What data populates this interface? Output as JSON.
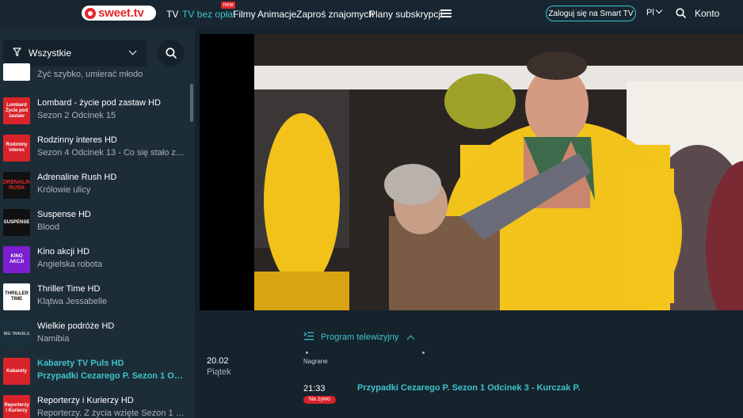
{
  "header": {
    "logo_text": "sweet.tv",
    "nav": [
      {
        "label": "TV"
      },
      {
        "label": "TV bez opłat",
        "badge": "new"
      },
      {
        "label": "Filmy"
      },
      {
        "label": "Animacje"
      },
      {
        "label": "Zaproś znajomych"
      },
      {
        "label": "Plany subskrypcji"
      }
    ],
    "smart_tv_button": "Zaloguj się na Smart TV",
    "language": "Pl",
    "account": "Konto"
  },
  "sidebar": {
    "filter_label": "Wszystkie",
    "channels": [
      {
        "name": "",
        "show": "Żyć szybko, umierać młodo",
        "logo_text": "",
        "logo_color": "#e5262b"
      },
      {
        "name": "Lombard - życie pod zastaw HD",
        "show": "Sezon 2 Odcinek 15",
        "logo_text": "Lombard Życie pod zastaw",
        "logo_color": "#d9232a"
      },
      {
        "name": "Rodzinny interes HD",
        "show": "Sezon 4 Odcinek 13 - Co się stało z ci...",
        "logo_text": "Rodzinny interes",
        "logo_color": "#d9232a"
      },
      {
        "name": "Adrenaline Rush HD",
        "show": "Królowie ulicy",
        "logo_text": "ADRENALINE RUSH",
        "logo_color": "#111111"
      },
      {
        "name": "Suspense HD",
        "show": "Blood",
        "logo_text": "SUSPENSE",
        "logo_color": "#111111"
      },
      {
        "name": "Kino akcji HD",
        "show": "Angielska robota",
        "logo_text": "KINO AKCJI",
        "logo_color": "#7b1fd1"
      },
      {
        "name": "Thriller Time HD",
        "show": "Klątwa Jessabelle",
        "logo_text": "THRILLER TIME",
        "logo_color": "#ffffff"
      },
      {
        "name": "Wielkie podróże HD",
        "show": "Namibia",
        "logo_text": "BIG TRAVELS",
        "logo_color": "#18303a"
      },
      {
        "name": "Kabarety TV Puls HD",
        "show": "Przypadki Cezarego P. Sezon 1 Odcinek...",
        "logo_text": "Kabarety",
        "logo_color": "#d9232a",
        "active": true
      },
      {
        "name": "Reporterzy i Kurierzy HD",
        "show": "Reporterzy. Z życia wzięte Sezon 1 Od...",
        "logo_text": "Reporterzy i Kurierzy",
        "logo_color": "#d9232a"
      }
    ]
  },
  "epg": {
    "toggle_label": "Program telewizyjny",
    "date": "20.02",
    "day": "Piątek",
    "recorded_label": "Nagrane",
    "time": "21:33",
    "live_label": "Na żywo",
    "program_title": "Przypadki Cezarego P. Sezon 1 Odcinek 3 - Kurczak P."
  },
  "colors": {
    "accent": "#3ec3cc",
    "brand": "#e5262b",
    "background": "#15232d",
    "sidebar": "#1d2d38"
  }
}
